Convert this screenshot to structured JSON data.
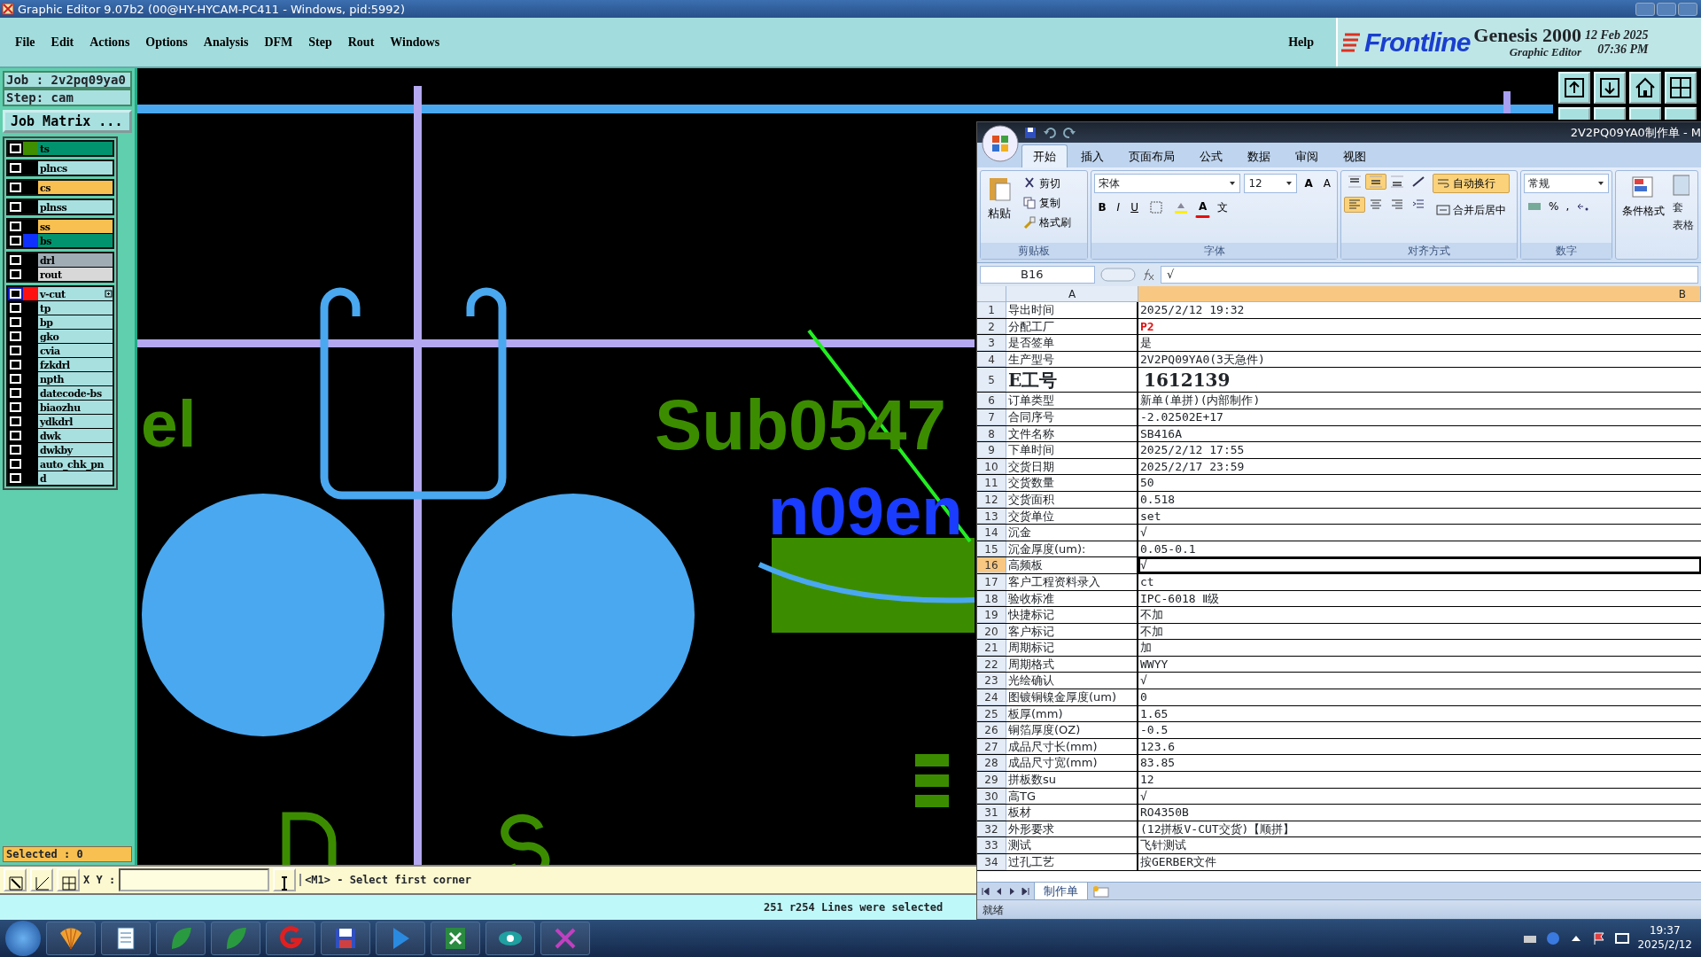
{
  "window": {
    "title": "Graphic Editor 9.07b2 (00@HY-HYCAM-PC411 - Windows, pid:5992)"
  },
  "menu": [
    "File",
    "Edit",
    "Actions",
    "Options",
    "Analysis",
    "DFM",
    "Step",
    "Rout",
    "Windows"
  ],
  "help": "Help",
  "brand": {
    "logo": "Frontline",
    "product": "Genesis 2000",
    "subtitle": "Graphic Editor",
    "date": "12 Feb 2025",
    "time": "07:36 PM"
  },
  "job": {
    "job": "Job : 2v2pq09ya0",
    "step": "Step: cam",
    "matrix_button": "Job Matrix ..."
  },
  "layer_groups": [
    [
      {
        "name": "ts",
        "color": "#3f8f00",
        "kind": "mask",
        "active": false,
        "checked": false
      }
    ],
    [
      {
        "name": "plncs",
        "kind": "misc",
        "active": false,
        "checked": false
      }
    ],
    [
      {
        "name": "cs",
        "kind": "signal",
        "active": false,
        "checked": false
      }
    ],
    [
      {
        "name": "plnss",
        "kind": "misc",
        "active": false,
        "checked": false
      }
    ],
    [
      {
        "name": "ss",
        "kind": "signal",
        "active": false,
        "checked": false
      },
      {
        "name": "bs",
        "color": "#1030ff",
        "kind": "mask",
        "active": false,
        "checked": false
      }
    ],
    [
      {
        "name": "drl",
        "kind": "drill",
        "active": false,
        "checked": false
      },
      {
        "name": "rout",
        "kind": "rout",
        "active": false,
        "checked": false
      }
    ],
    [
      {
        "name": "v-cut",
        "color": "#ff1010",
        "kind": "misc",
        "active": true,
        "checked": false
      },
      {
        "name": "tp",
        "kind": "misc",
        "active": false,
        "checked": false
      },
      {
        "name": "bp",
        "kind": "misc",
        "active": false,
        "checked": false
      },
      {
        "name": "gko",
        "kind": "misc",
        "active": false,
        "checked": false
      },
      {
        "name": "cvia",
        "kind": "misc",
        "active": false,
        "checked": false
      },
      {
        "name": "fzkdrl",
        "kind": "misc",
        "active": false,
        "checked": false
      },
      {
        "name": "npth",
        "kind": "misc",
        "active": false,
        "checked": false
      },
      {
        "name": "datecode-bs",
        "kind": "misc",
        "active": false,
        "checked": false
      },
      {
        "name": "biaozhu",
        "kind": "misc",
        "active": false,
        "checked": false
      },
      {
        "name": "ydkdrl",
        "kind": "misc",
        "active": false,
        "checked": false
      },
      {
        "name": "dwk",
        "kind": "misc",
        "active": false,
        "checked": false
      },
      {
        "name": "dwkby",
        "kind": "misc",
        "active": false,
        "checked": false
      },
      {
        "name": "auto_chk_pn",
        "kind": "misc",
        "active": false,
        "checked": false
      },
      {
        "name": "d",
        "kind": "misc",
        "active": false,
        "checked": false
      }
    ]
  ],
  "selected_count": "Selected : 0",
  "canvas": {
    "texts": [
      "el",
      "Sub0547",
      "n09en"
    ]
  },
  "command": {
    "xy_label": "X Y :",
    "prompt": "<M1> - Select first corner"
  },
  "status": "251 r254 Lines were selected",
  "excel": {
    "title": "2V2PQ09YA0制作单 - M",
    "tabs": [
      {
        "label": "开始",
        "selected": true
      },
      {
        "label": "插入",
        "selected": false
      },
      {
        "label": "页面布局",
        "selected": false
      },
      {
        "label": "公式",
        "selected": false
      },
      {
        "label": "数据",
        "selected": false
      },
      {
        "label": "审阅",
        "selected": false
      },
      {
        "label": "视图",
        "selected": false
      }
    ],
    "clipboard": {
      "paste": "粘贴",
      "cut": "剪切",
      "copy": "复制",
      "painter": "格式刷",
      "label": "剪贴板"
    },
    "font": {
      "face": "宋体",
      "size": "12",
      "grow": "A",
      "shrink": "A",
      "bold": "B",
      "italic": "I",
      "underline": "U",
      "color_letter": "A",
      "phonetic": "文",
      "label": "字体"
    },
    "align": {
      "valign": [
        false,
        true,
        false
      ],
      "halign": [
        true,
        false,
        false
      ],
      "wrap": "自动换行",
      "wrap_on": true,
      "merge": "合并后居中",
      "label": "对齐方式"
    },
    "number": {
      "format": "常规",
      "percent": "%",
      "comma": ",",
      "label": "数字"
    },
    "styles": {
      "conditional": "条件格式",
      "table_top": "套",
      "table_bottom": "表格"
    },
    "name_box": "B16",
    "formula": "√",
    "columns": [
      "A",
      "B"
    ],
    "rows": [
      {
        "n": "1",
        "label": "导出时间",
        "value": "2025/2/12 19:32",
        "kind": "plain",
        "selected": false
      },
      {
        "n": "2",
        "label": "分配工厂",
        "value": "P2",
        "kind": "alert",
        "selected": false
      },
      {
        "n": "3",
        "label": "是否签单",
        "value": "是",
        "kind": "plain",
        "selected": false
      },
      {
        "n": "4",
        "label": "生产型号",
        "value": "2V2PQ09YA0(3天急件)",
        "kind": "plain",
        "selected": false
      },
      {
        "n": "5",
        "label": "E工号",
        "value": "1612139",
        "kind": "large",
        "selected": false
      },
      {
        "n": "6",
        "label": "订单类型",
        "value": "新单(单拼)(内部制作)",
        "kind": "plain",
        "selected": false
      },
      {
        "n": "7",
        "label": "合同序号",
        "value": "-2.02502E+17",
        "kind": "plain",
        "selected": false
      },
      {
        "n": "8",
        "label": "文件名称",
        "value": "SB416A",
        "kind": "plain",
        "selected": false
      },
      {
        "n": "9",
        "label": "下单时间",
        "value": "2025/2/12 17:55",
        "kind": "plain",
        "selected": false
      },
      {
        "n": "10",
        "label": "交货日期",
        "value": "2025/2/17 23:59",
        "kind": "plain",
        "selected": false
      },
      {
        "n": "11",
        "label": "交货数量",
        "value": "50",
        "kind": "plain",
        "selected": false
      },
      {
        "n": "12",
        "label": "交货面积",
        "value": "0.518",
        "kind": "plain",
        "selected": false
      },
      {
        "n": "13",
        "label": "交货单位",
        "value": "set",
        "kind": "plain",
        "selected": false
      },
      {
        "n": "14",
        "label": "沉金",
        "value": "√",
        "kind": "plain",
        "selected": false
      },
      {
        "n": "15",
        "label": "沉金厚度(um):",
        "value": "0.05-0.1",
        "kind": "plain",
        "selected": false
      },
      {
        "n": "16",
        "label": "高频板",
        "value": "√",
        "kind": "plain",
        "selected": true
      },
      {
        "n": "17",
        "label": "客户工程资料录入",
        "value": "ct",
        "kind": "plain",
        "selected": false
      },
      {
        "n": "18",
        "label": "验收标准",
        "value": "IPC-6018 Ⅱ级",
        "kind": "plain",
        "selected": false
      },
      {
        "n": "19",
        "label": "快捷标记",
        "value": "不加",
        "kind": "plain",
        "selected": false
      },
      {
        "n": "20",
        "label": "客户标记",
        "value": "不加",
        "kind": "plain",
        "selected": false
      },
      {
        "n": "21",
        "label": "周期标记",
        "value": "加",
        "kind": "plain",
        "selected": false
      },
      {
        "n": "22",
        "label": "周期格式",
        "value": "WWYY",
        "kind": "plain",
        "selected": false
      },
      {
        "n": "23",
        "label": "光绘确认",
        "value": "√",
        "kind": "plain",
        "selected": false
      },
      {
        "n": "24",
        "label": "图镀铜镍金厚度(um)",
        "value": "0",
        "kind": "plain",
        "selected": false
      },
      {
        "n": "25",
        "label": "板厚(mm)",
        "value": "1.65",
        "kind": "plain",
        "selected": false
      },
      {
        "n": "26",
        "label": "铜箔厚度(OZ)",
        "value": "-0.5",
        "kind": "plain",
        "selected": false
      },
      {
        "n": "27",
        "label": "成品尺寸长(mm)",
        "value": "123.6",
        "kind": "plain",
        "selected": false
      },
      {
        "n": "28",
        "label": "成品尺寸宽(mm)",
        "value": "83.85",
        "kind": "plain",
        "selected": false
      },
      {
        "n": "29",
        "label": "拼板数su",
        "value": "12",
        "kind": "plain",
        "selected": false
      },
      {
        "n": "30",
        "label": "高TG",
        "value": "√",
        "kind": "plain",
        "selected": false
      },
      {
        "n": "31",
        "label": "板材",
        "value": "RO4350B",
        "kind": "plain",
        "selected": false
      },
      {
        "n": "32",
        "label": "外形要求",
        "value": "(12拼板V-CUT交货)【顺拼】",
        "kind": "plain",
        "selected": false
      },
      {
        "n": "33",
        "label": "测试",
        "value": "飞针测试",
        "kind": "plain",
        "selected": false
      },
      {
        "n": "34",
        "label": "过孔工艺",
        "value": "按GERBER文件",
        "kind": "plain",
        "selected": false
      }
    ],
    "sheet": "制作单",
    "status": "就绪"
  },
  "taskbar": {
    "time": "19:37",
    "date": "2025/2/12"
  }
}
